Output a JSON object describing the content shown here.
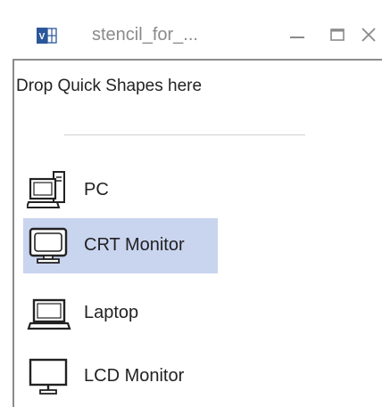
{
  "window": {
    "title": "stencil_for_...",
    "icons": {
      "app": "visio-icon",
      "minimize": "minimize-icon",
      "maximize": "maximize-icon",
      "close": "close-icon"
    }
  },
  "stencil": {
    "drop_hint": "Drop Quick Shapes here",
    "shapes": [
      {
        "label": "PC",
        "icon": "pc-icon",
        "selected": false
      },
      {
        "label": "CRT Monitor",
        "icon": "crt-monitor-icon",
        "selected": true
      },
      {
        "label": "Laptop",
        "icon": "laptop-icon",
        "selected": false
      },
      {
        "label": "LCD Monitor",
        "icon": "lcd-monitor-icon",
        "selected": false
      }
    ]
  },
  "colors": {
    "selection": "#c9d4ef",
    "title_text": "#8a8a8a",
    "app_icon_blue": "#2b579a"
  }
}
